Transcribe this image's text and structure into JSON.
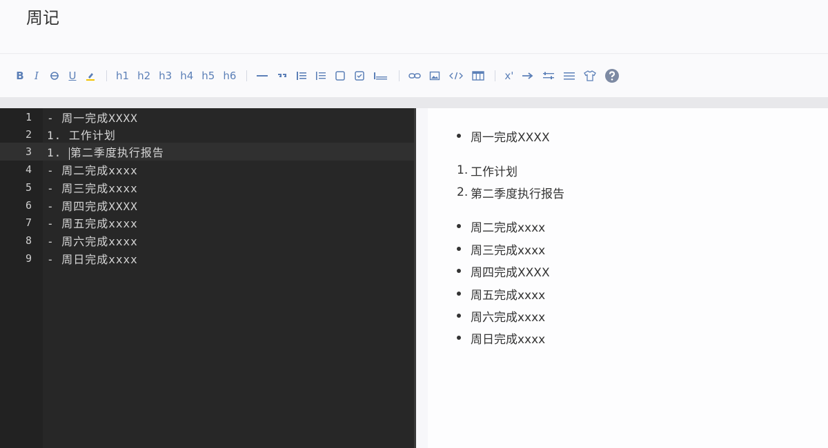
{
  "title": "周记",
  "toolbar": {
    "bold": "B",
    "italic": "I",
    "underline": "U",
    "h1": "h1",
    "h2": "h2",
    "h3": "h3",
    "h4": "h4",
    "h5": "h5",
    "h6": "h6",
    "superscript": "x'",
    "icons": [
      "bold",
      "italic",
      "strikethrough-icon",
      "underline",
      "highlighter-icon",
      "h1",
      "h2",
      "h3",
      "h4",
      "h5",
      "h6",
      "horizontal-rule-icon",
      "quote-icon",
      "unordered-list-icon",
      "ordered-list-icon",
      "checkbox-empty-icon",
      "checkbox-checked-icon",
      "code-block-icon",
      "link-icon",
      "image-icon",
      "code-icon",
      "table-icon",
      "superscript",
      "arrow-right-icon",
      "align-icon",
      "menu-icon",
      "shirt-icon",
      "help-icon"
    ]
  },
  "editor": {
    "lines": [
      {
        "num": "1",
        "text": "- 周一完成XXXX"
      },
      {
        "num": "2",
        "text": "1. 工作计划"
      },
      {
        "num": "3",
        "text": "1. 第二季度执行报告"
      },
      {
        "num": "4",
        "text": "- 周二完成xxxx"
      },
      {
        "num": "5",
        "text": "- 周三完成xxxx"
      },
      {
        "num": "6",
        "text": "- 周四完成XXXX"
      },
      {
        "num": "7",
        "text": "- 周五完成xxxx"
      },
      {
        "num": "8",
        "text": "- 周六完成xxxx"
      },
      {
        "num": "9",
        "text": "- 周日完成xxxx"
      }
    ],
    "active_line": 3
  },
  "preview": {
    "list1": [
      "周一完成XXXX"
    ],
    "ordered": [
      {
        "num": "1.",
        "text": "工作计划"
      },
      {
        "num": "2.",
        "text": "第二季度执行报告"
      }
    ],
    "list2": [
      "周二完成xxxx",
      "周三完成xxxx",
      "周四完成XXXX",
      "周五完成xxxx",
      "周六完成xxxx",
      "周日完成xxxx"
    ]
  }
}
